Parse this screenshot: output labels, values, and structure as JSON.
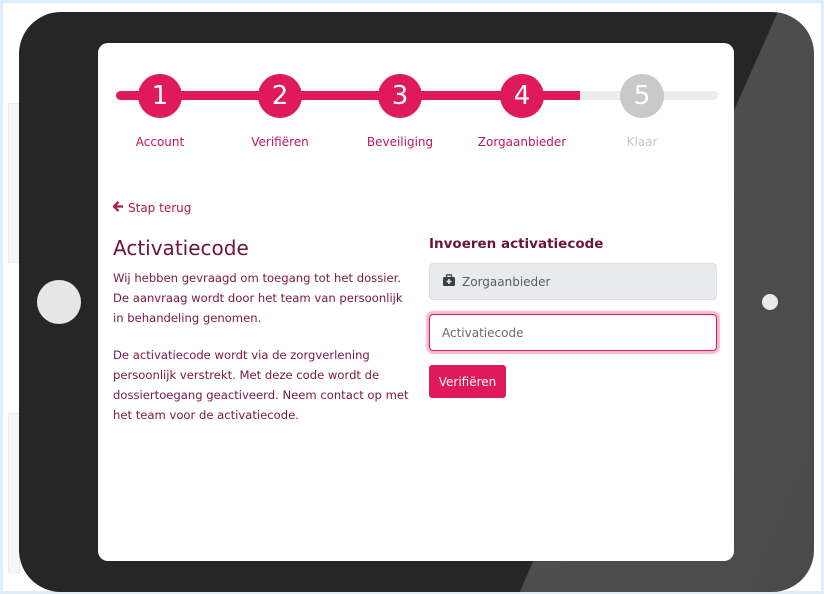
{
  "stepper": {
    "steps": [
      {
        "number": "1",
        "label": "Account",
        "state": "done"
      },
      {
        "number": "2",
        "label": "Verifiëren",
        "state": "done"
      },
      {
        "number": "3",
        "label": "Beveiliging",
        "state": "done"
      },
      {
        "number": "4",
        "label": "Zorgaanbieder",
        "state": "active"
      },
      {
        "number": "5",
        "label": "Klaar",
        "state": "inactive"
      }
    ]
  },
  "back_link": {
    "label": "Stap terug",
    "icon": "arrow-left-icon"
  },
  "main": {
    "title": "Activatiecode",
    "paragraph_1": "Wij hebben gevraagd om toegang tot het dossier. De aanvraag wordt door het team van persoonlijk in behandeling genomen.",
    "paragraph_2": "De activatiecode wordt via de zorgverlening persoonlijk verstrekt. Met deze code wordt de dossiertoegang geactiveerd. Neem contact op met het team voor de activatiecode."
  },
  "form": {
    "title": "Invoeren activatiecode",
    "provider_field": {
      "value": "Zorgaanbieder",
      "icon": "medical-kit-icon"
    },
    "code_field": {
      "placeholder": "Activatiecode",
      "value": ""
    },
    "submit_label": "Verifiëren"
  },
  "colors": {
    "accent": "#e0195d",
    "text_dark": "#6b1539",
    "inactive": "#c9c9c9",
    "tablet_body": "#262626"
  }
}
